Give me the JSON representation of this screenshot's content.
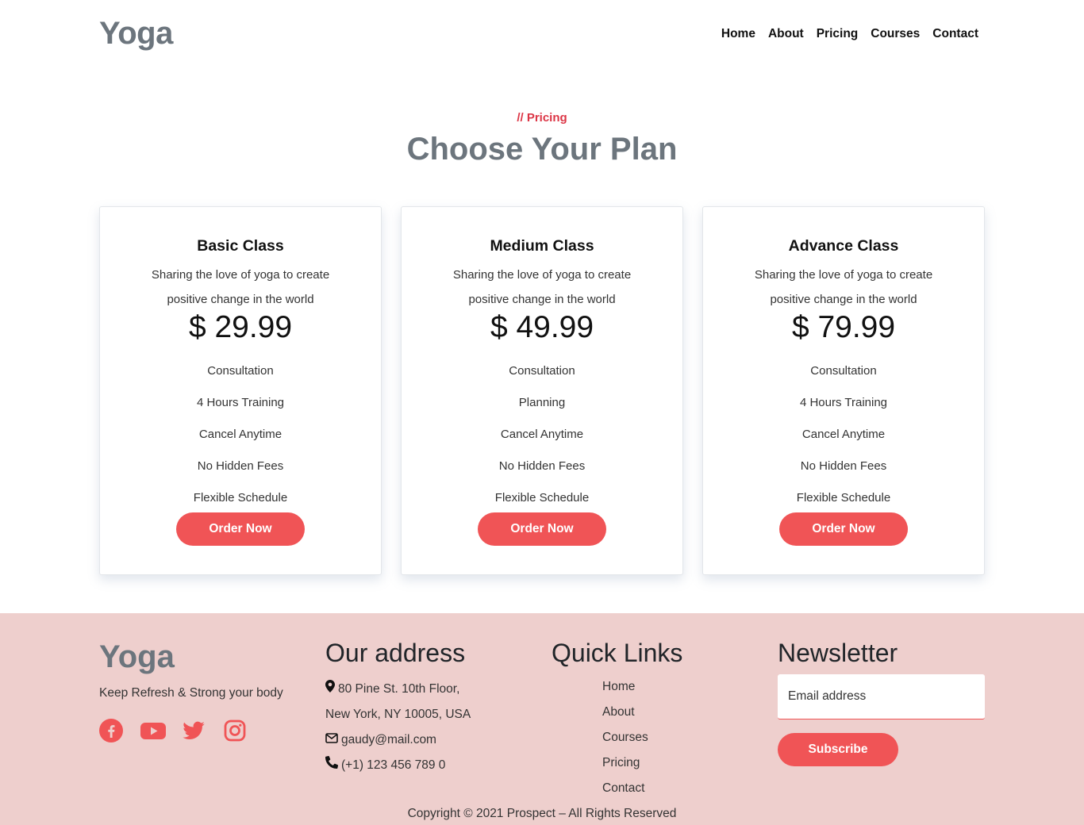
{
  "header": {
    "logo": "Yoga",
    "nav": [
      "Home",
      "About",
      "Pricing",
      "Courses",
      "Contact"
    ]
  },
  "pricing": {
    "tag": "// Pricing",
    "title": "Choose Your Plan",
    "plans": [
      {
        "title": "Basic Class",
        "description": "Sharing the love of yoga to create positive change in the world",
        "price": "$ 29.99",
        "features": [
          "Consultation",
          "4 Hours Training",
          "Cancel Anytime",
          "No Hidden Fees",
          "Flexible Schedule"
        ],
        "button": "Order Now"
      },
      {
        "title": "Medium Class",
        "description": "Sharing the love of yoga to create positive change in the world",
        "price": "$ 49.99",
        "features": [
          "Consultation",
          "Planning",
          "Cancel Anytime",
          "No Hidden Fees",
          "Flexible Schedule"
        ],
        "button": "Order Now"
      },
      {
        "title": "Advance Class",
        "description": "Sharing the love of yoga to create positive change in the world",
        "price": "$ 79.99",
        "features": [
          "Consultation",
          "4 Hours Training",
          "Cancel Anytime",
          "No Hidden Fees",
          "Flexible Schedule"
        ],
        "button": "Order Now"
      }
    ]
  },
  "footer": {
    "logo": "Yoga",
    "tagline": "Keep Refresh & Strong your body",
    "socials": [
      "facebook-icon",
      "youtube-icon",
      "twitter-icon",
      "instagram-icon"
    ],
    "address_heading": "Our address",
    "address_line1": "80 Pine St. 10th Floor,",
    "address_line2": "New York, NY 10005, USA",
    "email": "gaudy@mail.com",
    "phone": "(+1) 123 456 789 0",
    "quick_links_heading": "Quick Links",
    "quick_links": [
      "Home",
      "About",
      "Courses",
      "Pricing",
      "Contact"
    ],
    "newsletter_heading": "Newsletter",
    "email_placeholder": "Email address",
    "subscribe_label": "Subscribe",
    "copyright": "Copyright © 2021 Prospect – All Rights Reserved"
  },
  "colors": {
    "accent": "#f05456",
    "heading_gray": "#6c757d",
    "footer_bg": "#eecfcd",
    "tag_red": "#dc3545"
  }
}
